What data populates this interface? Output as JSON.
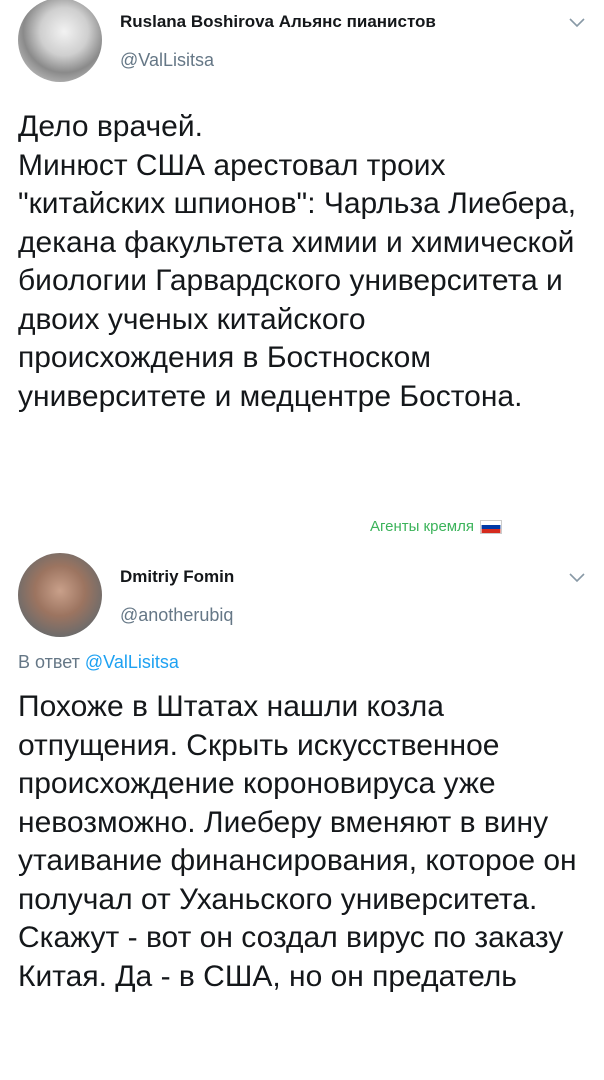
{
  "tweet1": {
    "author_name": "Ruslana Boshirova Альянс пианистов",
    "handle": "@ValLisitsa",
    "text": "Дело врачей.\nМинюст США арестовал троих \"китайских шпионов\": Чарльза Лиебера, декана факультета химии и химической биологии Гарвардского университета и двоих ученых китайского происхождения в Бостноском университете и медцентре Бостона.",
    "menu_icon": "chevron-down-icon",
    "watermark": "Агенты кремля",
    "flag_colors": [
      "#ffffff",
      "#0039a6",
      "#d52b1e"
    ]
  },
  "tweet2": {
    "author_name": "Dmitriy Fomin",
    "handle": "@anotherubiq",
    "reply_prefix": "В ответ",
    "reply_to": "@ValLisitsa",
    "text": "Похоже в Штатах нашли козла отпущения. Скрыть искусственное происхождение короновируса уже невозможно. Лиеберу вменяют в вину утаивание финансирования, которое он получал от Уханьского университета. Скажут -  вот  он создал вирус по заказу Китая. Да - в США, но он предатель",
    "menu_icon": "chevron-down-icon"
  },
  "colors": {
    "text": "#14171a",
    "secondary": "#657786",
    "link": "#1da1f2",
    "watermark": "#3bb35a"
  }
}
